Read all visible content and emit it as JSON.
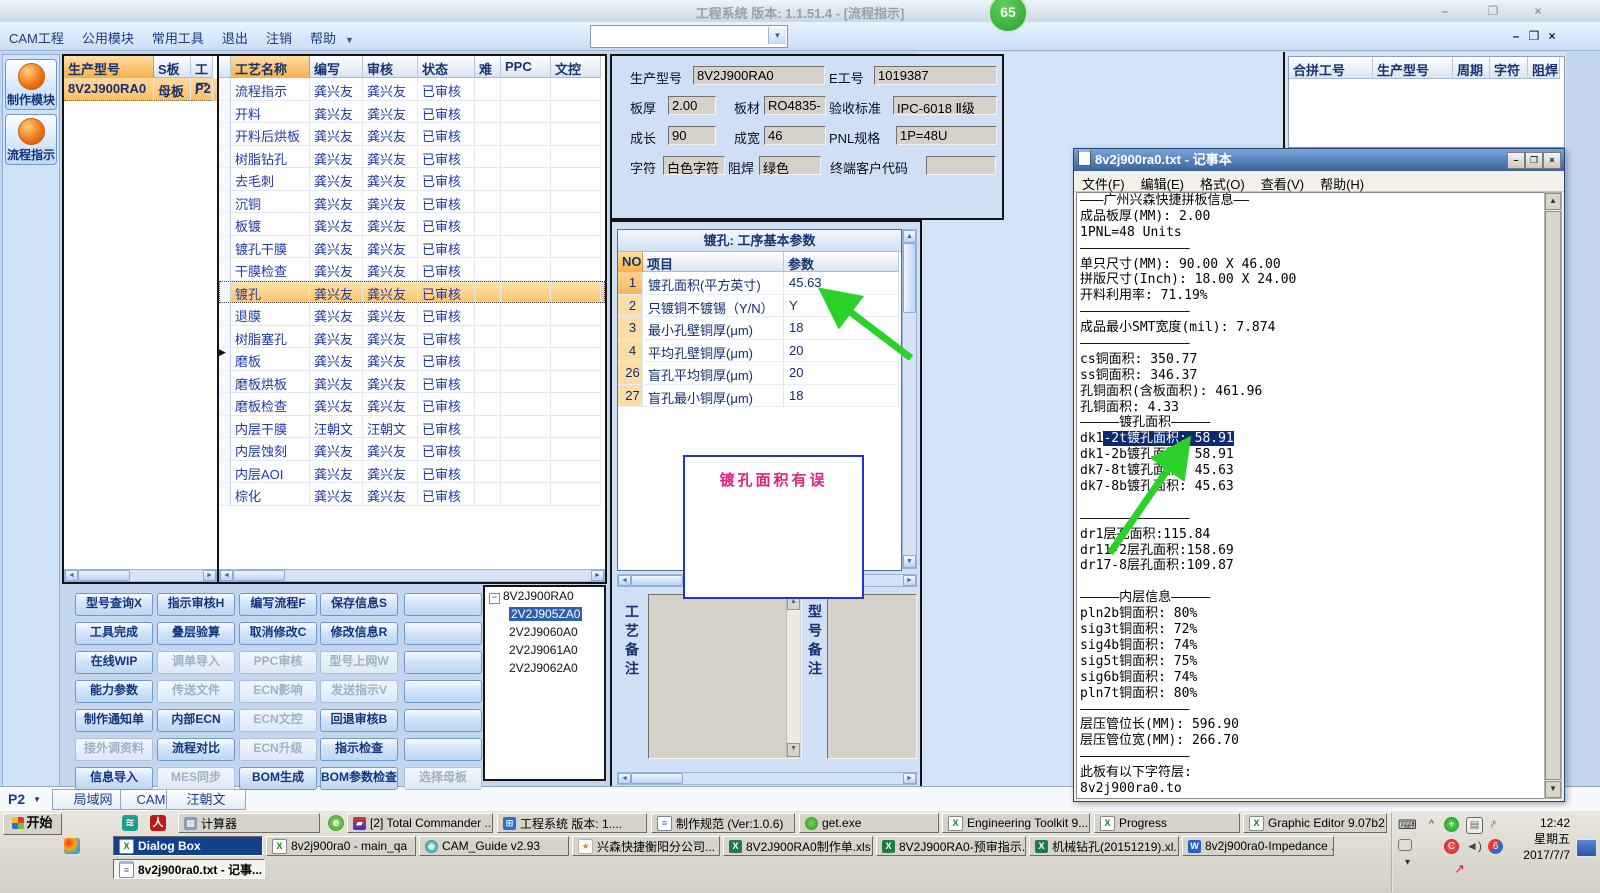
{
  "window": {
    "title": "工程系统  版本: 1.1.51.4 - [流程指示]",
    "badge": "65"
  },
  "colors": {
    "accent_orange": "#f9b24e",
    "arrow_green": "#29d129",
    "selection_navy": "#0b2a70",
    "annotation_pink": "#e31e83"
  },
  "menu": {
    "items": [
      "CAM工程",
      "公用模块",
      "常用工具",
      "退出",
      "注销",
      "帮助"
    ],
    "combo_value": ""
  },
  "sidebar": {
    "buttons": [
      {
        "label": "制作模块",
        "icon": "make-module-icon"
      },
      {
        "label": "流程指示",
        "icon": "process-indicator-icon"
      }
    ]
  },
  "board_table": {
    "headers": [
      "生产型号",
      "S板",
      "工厂"
    ],
    "rows": [
      [
        "8V2J900RA0",
        "母板",
        "P2"
      ]
    ]
  },
  "process_table": {
    "headers": [
      "工艺名称",
      "编写",
      "审核",
      "状态",
      "难",
      "PPC",
      "文控"
    ],
    "selected_index": 9,
    "rows": [
      [
        "流程指示",
        "龚兴友",
        "龚兴友",
        "已审核"
      ],
      [
        "开料",
        "龚兴友",
        "龚兴友",
        "已审核"
      ],
      [
        "开料后烘板",
        "龚兴友",
        "龚兴友",
        "已审核"
      ],
      [
        "树脂钻孔",
        "龚兴友",
        "龚兴友",
        "已审核"
      ],
      [
        "去毛刺",
        "龚兴友",
        "龚兴友",
        "已审核"
      ],
      [
        "沉铜",
        "龚兴友",
        "龚兴友",
        "已审核"
      ],
      [
        "板镀",
        "龚兴友",
        "龚兴友",
        "已审核"
      ],
      [
        "镀孔干膜",
        "龚兴友",
        "龚兴友",
        "已审核"
      ],
      [
        "干膜检查",
        "龚兴友",
        "龚兴友",
        "已审核"
      ],
      [
        "镀孔",
        "龚兴友",
        "龚兴友",
        "已审核"
      ],
      [
        "退膜",
        "龚兴友",
        "龚兴友",
        "已审核"
      ],
      [
        "树脂塞孔",
        "龚兴友",
        "龚兴友",
        "已审核"
      ],
      [
        "磨板",
        "龚兴友",
        "龚兴友",
        "已审核"
      ],
      [
        "磨板烘板",
        "龚兴友",
        "龚兴友",
        "已审核"
      ],
      [
        "磨板检查",
        "龚兴友",
        "龚兴友",
        "已审核"
      ],
      [
        "内层干膜",
        "汪朝文",
        "汪朝文",
        "已审核"
      ],
      [
        "内层蚀刻",
        "龚兴友",
        "龚兴友",
        "已审核"
      ],
      [
        "内层AOI",
        "龚兴友",
        "龚兴友",
        "已审核"
      ],
      [
        "棕化",
        "龚兴友",
        "龚兴友",
        "已审核"
      ]
    ]
  },
  "info_form": {
    "fields": [
      {
        "label": "生产型号",
        "value": "8V2J900RA0"
      },
      {
        "label": "E工号",
        "value": "1019387"
      },
      {
        "label": "板厚",
        "value": "2.00"
      },
      {
        "label": "板材",
        "value": "RO4835-"
      },
      {
        "label": "验收标准",
        "value": "IPC-6018 Ⅱ级"
      },
      {
        "label": "成长",
        "value": "90"
      },
      {
        "label": "成宽",
        "value": "46"
      },
      {
        "label": "PNL规格",
        "value": "1P=48U"
      },
      {
        "label": "字符",
        "value": "白色字符"
      },
      {
        "label": "阻焊",
        "value": "绿色"
      },
      {
        "label": "终端客户代码",
        "value": ""
      }
    ]
  },
  "param_table": {
    "title": "镀孔: 工序基本参数",
    "headers": [
      "NO",
      "项目",
      "参数"
    ],
    "rows": [
      [
        "1",
        "镀孔面积(平方英寸)",
        "45.63"
      ],
      [
        "2",
        "只镀铜不镀锡（Y/N）",
        "Y"
      ],
      [
        "3",
        "最小孔壁铜厚(μm)",
        "18"
      ],
      [
        "4",
        "平均孔壁铜厚(μm)",
        "20"
      ],
      [
        "26",
        "盲孔平均铜厚(μm)",
        "20"
      ],
      [
        "27",
        "盲孔最小铜厚(μm)",
        "18"
      ]
    ]
  },
  "annotation": {
    "text": "镀孔面积有误"
  },
  "remarks": {
    "left": "工艺备注",
    "right": "型号备注"
  },
  "button_grid": {
    "rows": [
      [
        {
          "label": "型号查询X",
          "enabled": true
        },
        {
          "label": "指示审核H",
          "enabled": true
        },
        {
          "label": "编写流程F",
          "enabled": true
        },
        {
          "label": "保存信息S",
          "enabled": true
        },
        {
          "label": "",
          "enabled": true
        }
      ],
      [
        {
          "label": "工具完成",
          "enabled": true
        },
        {
          "label": "叠层验算",
          "enabled": true
        },
        {
          "label": "取消修改C",
          "enabled": true
        },
        {
          "label": "修改信息R",
          "enabled": true
        },
        {
          "label": "",
          "enabled": true
        }
      ],
      [
        {
          "label": "在线WIP",
          "enabled": true
        },
        {
          "label": "调单导入",
          "enabled": false
        },
        {
          "label": "PPC审核",
          "enabled": false
        },
        {
          "label": "型号上网W",
          "enabled": false
        },
        {
          "label": "",
          "enabled": true
        }
      ],
      [
        {
          "label": "能力参数",
          "enabled": true
        },
        {
          "label": "传送文件",
          "enabled": false
        },
        {
          "label": "ECN影响",
          "enabled": false
        },
        {
          "label": "发送指示V",
          "enabled": false
        },
        {
          "label": "",
          "enabled": true
        }
      ],
      [
        {
          "label": "制作通知单",
          "enabled": true
        },
        {
          "label": "内部ECN",
          "enabled": true
        },
        {
          "label": "ECN文控",
          "enabled": false
        },
        {
          "label": "回退审核B",
          "enabled": true
        },
        {
          "label": "",
          "enabled": true
        }
      ],
      [
        {
          "label": "接外调资料",
          "enabled": false
        },
        {
          "label": "流程对比",
          "enabled": true
        },
        {
          "label": "ECN升级",
          "enabled": false
        },
        {
          "label": "指示检查",
          "enabled": true
        },
        {
          "label": "",
          "enabled": true
        }
      ],
      [
        {
          "label": "信息导入",
          "enabled": true
        },
        {
          "label": "MES同步",
          "enabled": false
        },
        {
          "label": "BOM生成",
          "enabled": true
        },
        {
          "label": "BOM参数检查",
          "enabled": true
        },
        {
          "label": "选择母板",
          "enabled": false
        }
      ]
    ]
  },
  "tree": {
    "root": "8V2J900RA0",
    "children": [
      {
        "label": "2V2J905ZA0",
        "selected": true
      },
      {
        "label": "2V2J9060A0",
        "selected": false
      },
      {
        "label": "2V2J9061A0",
        "selected": false
      },
      {
        "label": "2V2J9062A0",
        "selected": false
      }
    ]
  },
  "merge_table": {
    "headers": [
      "合拼工号",
      "生产型号",
      "周期",
      "字符",
      "阻焊"
    ]
  },
  "notepad": {
    "title": "8v2j900ra0.txt - 记事本",
    "menu": [
      "文件(F)",
      "编辑(E)",
      "格式(O)",
      "查看(V)",
      "帮助(H)"
    ],
    "lines": [
      {
        "text": "———广州兴森快捷拼板信息——"
      },
      {
        "text": "成品板厚(MM): 2.00"
      },
      {
        "text": "1PNL=48 Units"
      },
      {
        "text": "——————————————"
      },
      {
        "text": "单只尺寸(MM): 90.00 X 46.00"
      },
      {
        "text": "拼版尺寸(Inch): 18.00 X 24.00"
      },
      {
        "text": "开料利用率: 71.19%"
      },
      {
        "text": "——————————————"
      },
      {
        "text": "成品最小SMT宽度(mil): 7.874"
      },
      {
        "text": "——————————————"
      },
      {
        "text": "cs铜面积: 350.77"
      },
      {
        "text": "ss铜面积: 346.37"
      },
      {
        "text": "孔铜面积(含板面积): 461.96"
      },
      {
        "text": "孔铜面积: 4.33"
      },
      {
        "text": "—————镀孔面积—————"
      },
      {
        "pre": "dk1",
        "sel": "-2t镀孔面积: 58.91"
      },
      {
        "text": "dk1-2b镀孔面积: 58.91"
      },
      {
        "text": "dk7-8t镀孔面积: 45.63"
      },
      {
        "text": "dk7-8b镀孔面积: 45.63"
      },
      {
        "text": ""
      },
      {
        "text": "——————————————"
      },
      {
        "text": "dr1层孔面积:115.84"
      },
      {
        "text": "dr11-2层孔面积:158.69"
      },
      {
        "text": "dr17-8层孔面积:109.87"
      },
      {
        "text": ""
      },
      {
        "text": "—————内层信息—————"
      },
      {
        "text": "pln2b铜面积: 80%"
      },
      {
        "text": "sig3t铜面积: 72%"
      },
      {
        "text": "sig4b铜面积: 74%"
      },
      {
        "text": "sig5t铜面积: 75%"
      },
      {
        "text": "sig6b铜面积: 74%"
      },
      {
        "text": "pln7t铜面积: 80%"
      },
      {
        "text": "——————————————"
      },
      {
        "text": "层压管位长(MM): 596.90"
      },
      {
        "text": "层压管位宽(MM): 266.70"
      },
      {
        "text": "——————————————"
      },
      {
        "text": "此板有以下字符层:"
      },
      {
        "text": "8v2j900ra0.to"
      }
    ]
  },
  "tabs_bar": {
    "current": "P2",
    "tabs": [
      "局域网",
      "CAM",
      "汪朝文"
    ]
  },
  "taskbar": {
    "start_label": "开始",
    "quick_launch": [
      "launcher-icon",
      "pdf-icon",
      "messenger-icon"
    ],
    "row1": [
      {
        "label": "计算器",
        "icon": "calculator-icon"
      },
      {
        "label": "[2] Total Commander ...",
        "icon": "disk-icon"
      },
      {
        "label": "工程系统  版本: 1....",
        "icon": "app-icon"
      },
      {
        "label": "制作规范 (Ver:1.0.6)",
        "icon": "doc-blue-icon"
      },
      {
        "label": "get.exe",
        "icon": "globe-icon"
      },
      {
        "label": "Engineering Toolkit 9...",
        "icon": "xtool-icon"
      },
      {
        "label": "Progress",
        "icon": "xtool-icon"
      },
      {
        "label": "Graphic Editor 9.07b2...",
        "icon": "xtool-icon"
      }
    ],
    "row2": [
      {
        "label": "Dialog Box",
        "icon": "xtool-icon",
        "active": true
      },
      {
        "label": "8v2j900ra0 - main_qa",
        "icon": "xtool-icon"
      },
      {
        "label": "CAM_Guide v2.93",
        "icon": "cam-icon"
      },
      {
        "label": "兴森快捷衡阳分公司...",
        "icon": "star-icon"
      },
      {
        "label": "8V2J900RA0制作单.xls ...",
        "icon": "excel-icon"
      },
      {
        "label": "8V2J900RA0-预审指示....",
        "icon": "excel-icon"
      },
      {
        "label": "机械钻孔(20151219).xl...",
        "icon": "excel-icon"
      },
      {
        "label": "8v2j900ra0-Impedance ...",
        "icon": "word-icon"
      }
    ],
    "row3": [
      {
        "label": "8v2j900ra0.txt - 记事...",
        "icon": "notepad-icon",
        "pressed": true
      }
    ],
    "tray": {
      "time": "12:42",
      "weekday": "星期五",
      "date": "2017/7/7"
    }
  }
}
